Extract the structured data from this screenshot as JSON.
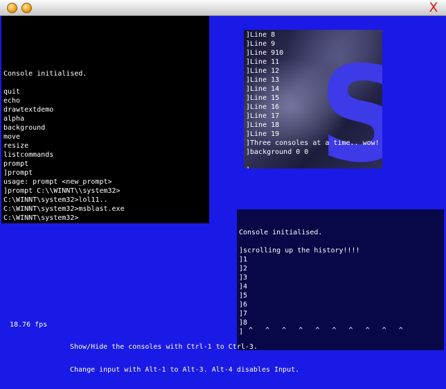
{
  "window": {
    "close_glyph": "X"
  },
  "console1": {
    "lines": [
      "Console initialised.",
      "",
      "quit",
      "echo",
      "drawtextdemo",
      "alpha",
      "background",
      "move",
      "resize",
      "listcommands",
      "prompt",
      "]prompt",
      "usage: prompt <new_prompt>",
      "]prompt C:\\\\WINNT\\\\system32>",
      "C:\\WINNT\\system32>lol11..",
      "C:\\WINNT\\system32>msblast.exe",
      "C:\\WINNT\\system32>"
    ]
  },
  "console2": {
    "logo_letter": "S",
    "lines": [
      "]Line 8",
      "]Line 9",
      "]Line 910",
      "]Line 11",
      "]Line 12",
      "]Line 13",
      "]Line 14",
      "]Line 15",
      "]Line 16",
      "]Line 17",
      "]Line 18",
      "]Line 19",
      "]Three consoles at a time.. wow!",
      "]background 0 0",
      "",
      "]"
    ]
  },
  "console3": {
    "lines": [
      "Console initialised.",
      "",
      "]scrolling up the history!!!!",
      "]1",
      "]2",
      "]3",
      "]4",
      "]5",
      "]6",
      "]7",
      "]8",
      "]"
    ]
  },
  "status": {
    "fps": "18.76 fps",
    "help_line1": "Show/Hide the consoles with Ctrl-1 to Ctrl-3.",
    "help_line2": "Change input with Alt-1 to Alt-3. Alt-4 disables Input.",
    "carets": "^   ^   ^   ^   ^   ^   ^   ^   ^   ^"
  }
}
